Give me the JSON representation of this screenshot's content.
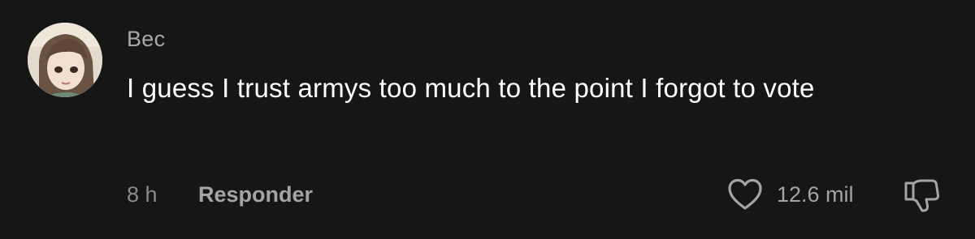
{
  "comment": {
    "username": "Bec",
    "text": "I guess I trust armys too much to the point I forgot to vote",
    "time": "8 h",
    "reply_label": "Responder",
    "like_count": "12.6 mil"
  },
  "icons": {
    "like": "heart-icon",
    "dislike": "thumbs-down-icon"
  },
  "colors": {
    "background": "#161616",
    "username": "#a8a8a8",
    "text": "#ffffff",
    "secondary": "#a4a4a4"
  }
}
